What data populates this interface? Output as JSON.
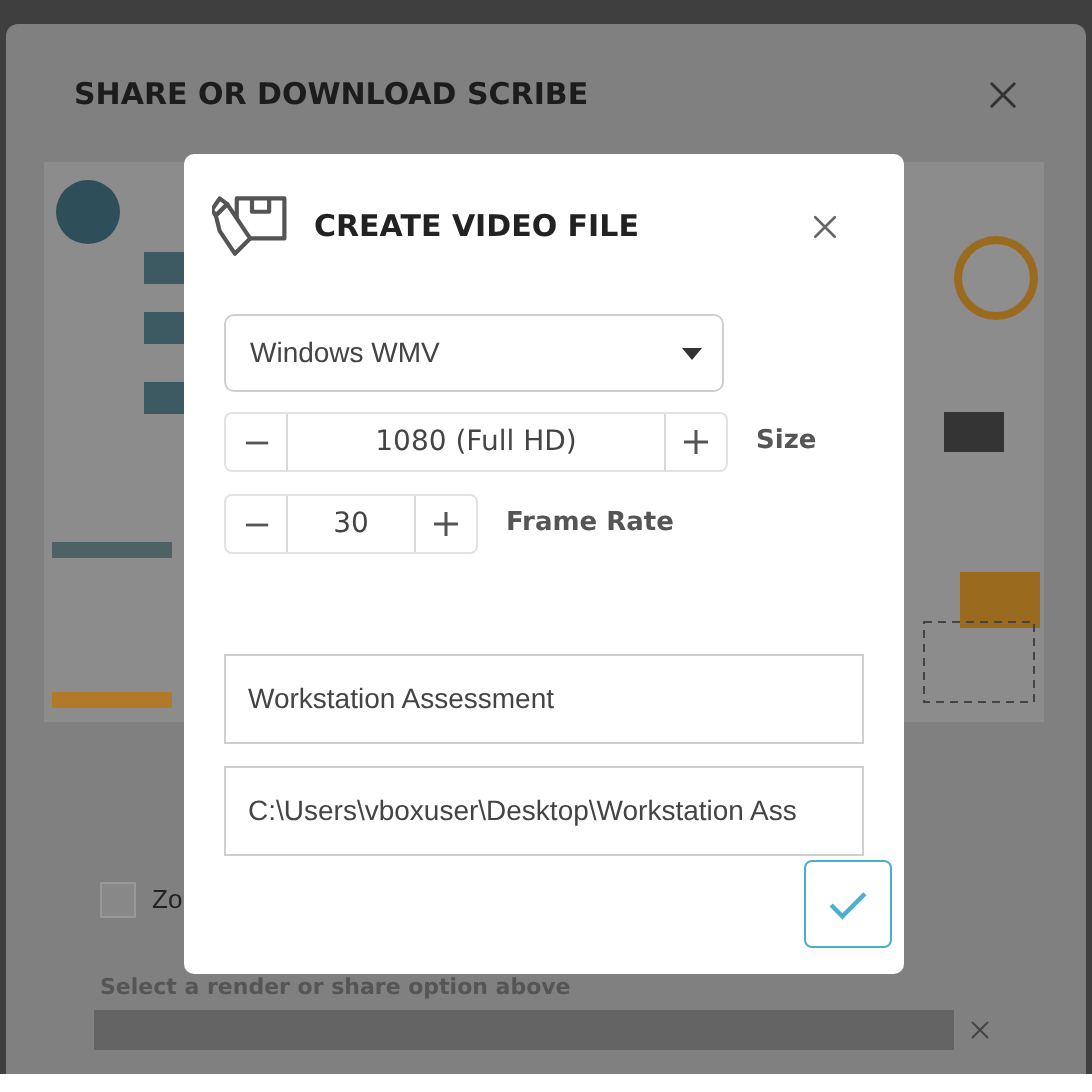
{
  "share_dialog": {
    "title": "SHARE OR DOWNLOAD SCRIBE",
    "zoom_option": {
      "label": "Zo",
      "checked": false
    },
    "status": "Select a render or share option above"
  },
  "video_dialog": {
    "title": "CREATE VIDEO FILE",
    "format": "Windows WMV",
    "size": {
      "value": "1080 (Full HD)",
      "label": "Size"
    },
    "frame_rate": {
      "value": "30",
      "label": "Frame Rate"
    },
    "file_name": "Workstation Assessment",
    "path": "C:\\Users\\vboxuser\\Desktop\\Workstation Ass"
  }
}
